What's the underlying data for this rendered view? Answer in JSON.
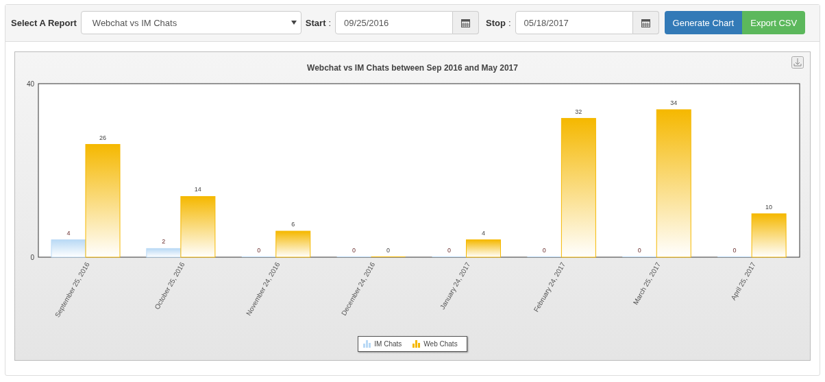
{
  "toolbar": {
    "report_label": "Select A Report",
    "report_value": "Webchat vs IM Chats",
    "start_label": "Start",
    "start_separator": ":",
    "start_value": "09/25/2016",
    "stop_label": "Stop",
    "stop_separator": ":",
    "stop_value": "05/18/2017",
    "buttons": [
      {
        "label": "Generate Chart",
        "kind": "primary"
      },
      {
        "label": "Export CSV",
        "kind": "success"
      }
    ]
  },
  "chart": {
    "chart_data": {
      "type": "bar",
      "title": "Webchat vs IM Chats between Sep 2016 and May 2017",
      "categories": [
        "September 25, 2016",
        "October 25, 2016",
        "November 24, 2016",
        "December 24, 2016",
        "January 24, 2017",
        "February 24, 2017",
        "March 25, 2017",
        "April 25, 2017"
      ],
      "series": [
        {
          "name": "IM Chats",
          "color": "#b9d9f5",
          "values": [
            4,
            2,
            0,
            0,
            0,
            0,
            0,
            0
          ]
        },
        {
          "name": "Web Chats",
          "color": "#f5b800",
          "values": [
            26,
            14,
            6,
            0,
            4,
            32,
            34,
            10
          ]
        }
      ],
      "ylim": [
        0,
        40
      ],
      "yticks": [
        0,
        40
      ],
      "data_labels": true
    }
  }
}
